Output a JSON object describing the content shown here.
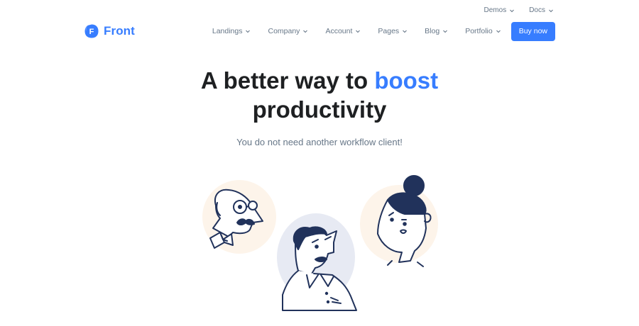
{
  "topbar": {
    "items": [
      {
        "label": "Demos",
        "icon": "chevron-down-icon"
      },
      {
        "label": "Docs",
        "icon": "chevron-down-icon"
      }
    ]
  },
  "brand": {
    "name": "Front",
    "logo_letter": "F",
    "logo_icon": "front-logo-icon"
  },
  "nav": {
    "items": [
      {
        "label": "Landings",
        "icon": "chevron-down-icon"
      },
      {
        "label": "Company",
        "icon": "chevron-down-icon"
      },
      {
        "label": "Account",
        "icon": "chevron-down-icon"
      },
      {
        "label": "Pages",
        "icon": "chevron-down-icon"
      },
      {
        "label": "Blog",
        "icon": "chevron-down-icon"
      },
      {
        "label": "Portfolio",
        "icon": "chevron-down-icon"
      }
    ],
    "cta_label": "Buy now"
  },
  "hero": {
    "title_prefix": "A better way to",
    "title_highlight": "boost",
    "title_suffix": "productivity",
    "subtitle": "You do not need another workflow client!"
  },
  "colors": {
    "primary": "#377dff",
    "heading": "#1e2022",
    "muted": "#677788",
    "highlight_underline": "#fbe7cf",
    "illustration_ink": "#21325b",
    "illustration_peach": "#fdf4ea",
    "illustration_gray": "#e7eaf3"
  }
}
